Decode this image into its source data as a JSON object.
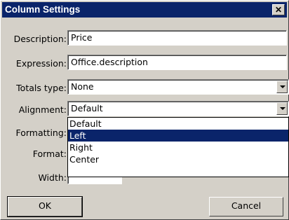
{
  "window": {
    "title": "Column Settings",
    "close_label": "✕"
  },
  "form": {
    "description": {
      "label": "Description:",
      "value": "Price"
    },
    "expression": {
      "label": "Expression:",
      "value": "Office.description"
    },
    "totals_type": {
      "label": "Totals type:",
      "value": "None"
    },
    "alignment": {
      "label": "Alignment:",
      "value": "Default"
    },
    "formatting": {
      "label": "Formatting:"
    },
    "format": {
      "label": "Format:"
    },
    "width": {
      "label": "Width:"
    }
  },
  "alignment_dropdown": {
    "options": [
      "Default",
      "Left",
      "Right",
      "Center"
    ],
    "highlighted": "Left"
  },
  "buttons": {
    "ok": "OK",
    "cancel": "Cancel"
  },
  "colors": {
    "titlebar": "#0a246a",
    "selection": "#0a246a",
    "face": "#d4d0c8"
  }
}
